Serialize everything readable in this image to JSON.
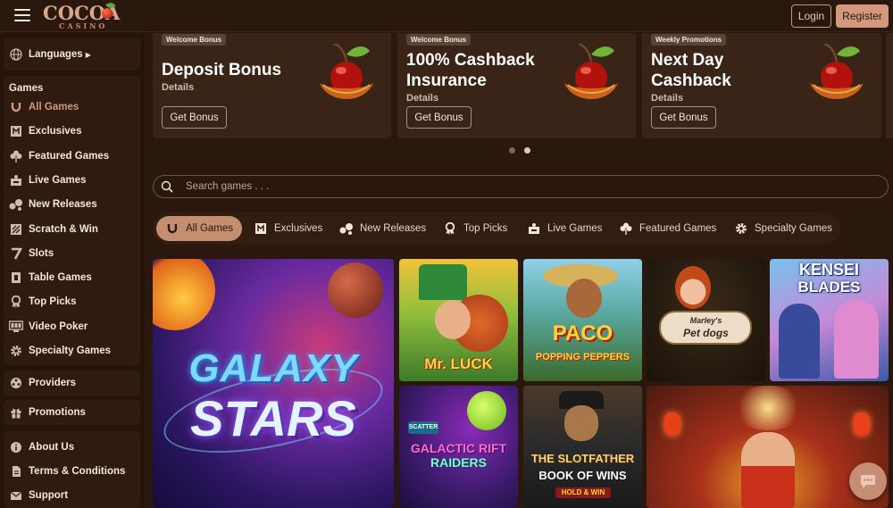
{
  "header": {
    "logo_main": "COCOA",
    "logo_sub": "CASINO",
    "login_label": "Login",
    "register_label": "Register"
  },
  "sidebar": {
    "languages_label": "Languages",
    "games_heading": "Games",
    "games": [
      {
        "label": "All Games",
        "icon": "horseshoe-icon",
        "active": true
      },
      {
        "label": "Exclusives",
        "icon": "exclusive-icon"
      },
      {
        "label": "Featured Games",
        "icon": "clover-icon"
      },
      {
        "label": "Live Games",
        "icon": "dealer-icon"
      },
      {
        "label": "New Releases",
        "icon": "new-icon"
      },
      {
        "label": "Scratch & Win",
        "icon": "scratch-icon"
      },
      {
        "label": "Slots",
        "icon": "seven-icon"
      },
      {
        "label": "Table Games",
        "icon": "table-icon"
      },
      {
        "label": "Top Picks",
        "icon": "medal-icon"
      },
      {
        "label": "Video Poker",
        "icon": "poker-icon"
      },
      {
        "label": "Specialty Games",
        "icon": "gear-icon"
      }
    ],
    "providers_label": "Providers",
    "promotions_label": "Promotions",
    "about_label": "About Us",
    "terms_label": "Terms & Conditions",
    "support_label": "Support"
  },
  "promos": [
    {
      "tag": "Welcome Bonus",
      "title_lines": [
        "Deposit Bonus"
      ],
      "details": "Details",
      "button": "Get Bonus"
    },
    {
      "tag": "Welcome Bonus",
      "title_lines": [
        "100% Cashback",
        "Insurance"
      ],
      "details": "Details",
      "button": "Get Bonus"
    },
    {
      "tag": "Weekly Promotions",
      "title_lines": [
        "Next Day",
        "Cashback"
      ],
      "details": "Details",
      "button": "Get Bonus"
    }
  ],
  "search": {
    "placeholder": "Search games . . ."
  },
  "tabs": [
    {
      "label": "All Games",
      "icon": "horseshoe-icon",
      "active": true
    },
    {
      "label": "Exclusives",
      "icon": "exclusive-icon"
    },
    {
      "label": "New Releases",
      "icon": "new-icon"
    },
    {
      "label": "Top Picks",
      "icon": "medal-icon"
    },
    {
      "label": "Live Games",
      "icon": "dealer-icon"
    },
    {
      "label": "Featured Games",
      "icon": "clover-icon"
    },
    {
      "label": "Specialty Games",
      "icon": "gear-icon"
    }
  ],
  "games": [
    {
      "title_l1": "GALAXY",
      "title_l2": "STARS"
    },
    {
      "title_l1": "Mr. LUCK",
      "title_l2": ""
    },
    {
      "title_l1": "PACO",
      "title_l2": "POPPING PEPPERS"
    },
    {
      "title_l1": "Marley's",
      "title_l2": "Pet dogs"
    },
    {
      "title_l1": "KENSEI",
      "title_l2": "BLADES"
    },
    {
      "title_l1": "GALACTIC RIFT",
      "title_l2": "RAIDERS",
      "badge": "SCATTER"
    },
    {
      "title_l1": "THE SLOTFATHER",
      "title_l2": "BOOK OF WINS",
      "badge": "HOLD & WIN"
    },
    {
      "title_l1": "",
      "title_l2": ""
    }
  ]
}
